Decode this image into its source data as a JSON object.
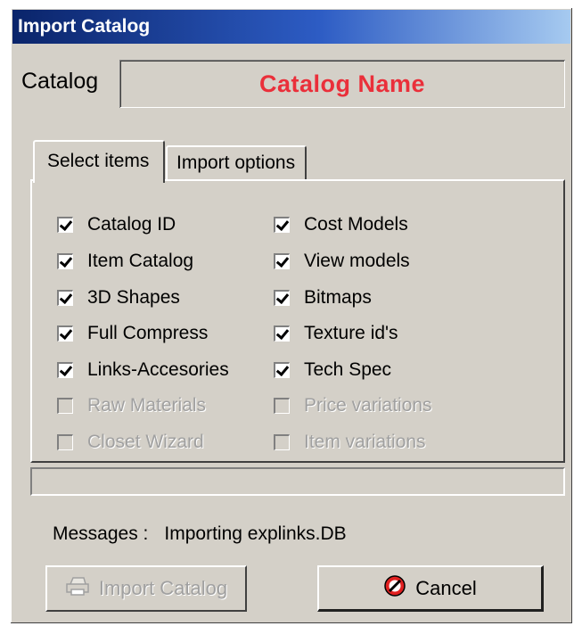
{
  "window": {
    "title": "Import Catalog"
  },
  "catalog": {
    "label": "Catalog",
    "name": "Catalog Name"
  },
  "tabs": [
    {
      "label": "Select items",
      "active": true
    },
    {
      "label": "Import options",
      "active": false
    }
  ],
  "items_left": [
    {
      "label": "Catalog ID",
      "checked": true,
      "enabled": true
    },
    {
      "label": "Item Catalog",
      "checked": true,
      "enabled": true
    },
    {
      "label": "3D Shapes",
      "checked": true,
      "enabled": true
    },
    {
      "label": "Full Compress",
      "checked": true,
      "enabled": true
    },
    {
      "label": "Links-Accesories",
      "checked": true,
      "enabled": true
    },
    {
      "label": "Raw Materials",
      "checked": false,
      "enabled": false
    },
    {
      "label": "Closet Wizard",
      "checked": false,
      "enabled": false
    }
  ],
  "items_right": [
    {
      "label": "Cost Models",
      "checked": true,
      "enabled": true
    },
    {
      "label": "View models",
      "checked": true,
      "enabled": true
    },
    {
      "label": "Bitmaps",
      "checked": true,
      "enabled": true
    },
    {
      "label": "Texture id's",
      "checked": true,
      "enabled": true
    },
    {
      "label": "Tech Spec",
      "checked": true,
      "enabled": true
    },
    {
      "label": "Price variations",
      "checked": false,
      "enabled": false
    },
    {
      "label": "Item variations",
      "checked": false,
      "enabled": false
    }
  ],
  "progress": {
    "value": 0
  },
  "messages": {
    "label": "Messages :",
    "value": "Importing explinks.DB"
  },
  "buttons": {
    "import_label": "Import Catalog",
    "import_icon": "printer-icon",
    "cancel_label": "Cancel",
    "cancel_icon": "cancel-icon"
  },
  "colors": {
    "titlebar": "#0a246a",
    "catalog_name": "#ea2f3a",
    "face": "#d4d0c8"
  }
}
